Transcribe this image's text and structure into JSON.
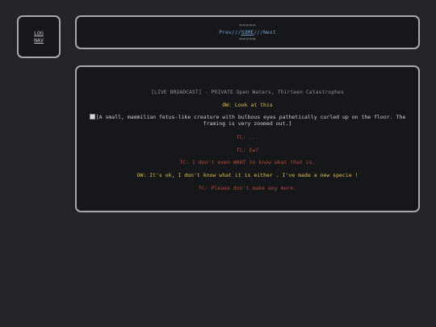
{
  "log_nav": {
    "line1": "LOG",
    "line2": "NAV"
  },
  "top_nav": {
    "top_equals": "=====",
    "prev": "Prev",
    "sep1": "///",
    "some": "SOME",
    "sep2": "///",
    "next": "Next",
    "bottom_equals": "====="
  },
  "log": {
    "title": "[LIVE BROADCAST] - PRIVATE Open Waters, Thirteen Catastrophes",
    "lines": [
      {
        "speaker": "OW",
        "text": "OW: Look at this"
      },
      {
        "speaker": "img",
        "text": "[A small, mammilian fetus-like creature with bulbous eyes pathetically curled up on the floor. The framing is very zoomed out.]"
      },
      {
        "speaker": "TC",
        "text": "TC: ..."
      },
      {
        "speaker": "TC",
        "text": "TC: Ew?"
      },
      {
        "speaker": "TC",
        "text": "TC: I don't even WANT to know what that is."
      },
      {
        "speaker": "OW",
        "text": "OW: It's ok, I don't know what it is either . I've made a new specie !"
      },
      {
        "speaker": "TC",
        "text": "TC: Please don't make any more."
      }
    ]
  },
  "colors": {
    "background": "#232427",
    "panel": "#16171a",
    "border": "#a8a8a8",
    "ow": "#e0c040",
    "tc": "#b84a32",
    "link": "#6e9bc9"
  }
}
